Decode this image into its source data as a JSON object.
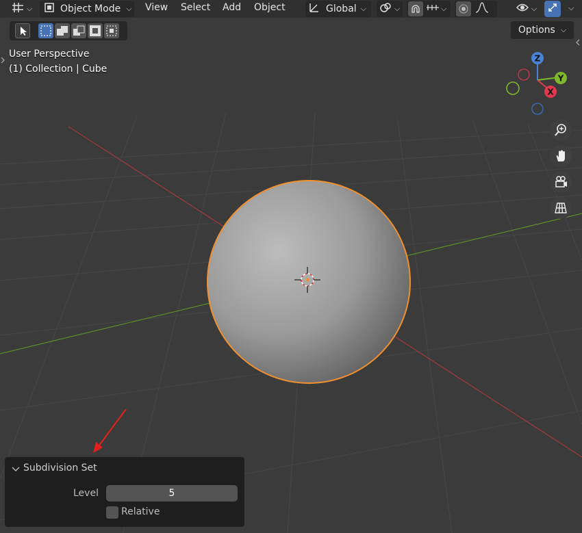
{
  "header": {
    "editor_type_icon": "grid-axes-icon",
    "mode_label": "Object Mode",
    "menus": [
      "View",
      "Select",
      "Add",
      "Object"
    ],
    "transform_orientation": "Global",
    "icons": [
      "pivot-icon",
      "snap-magnet-icon",
      "snap-increment-icon",
      "proportional-edit-icon",
      "falloff-curve-icon",
      "visibility-eye-icon",
      "gizmo-toggle-icon"
    ]
  },
  "toolbar": {
    "select_tool_icon": "cursor-arrow-icon",
    "select_modes": [
      "select-new-icon",
      "select-extend-icon",
      "select-subtract-icon",
      "select-invert-icon",
      "select-intersect-icon"
    ],
    "options_label": "Options"
  },
  "viewport": {
    "view_name": "User Perspective",
    "collection_info": "(1) Collection | Cube",
    "gizmo_axes": [
      "Z",
      "Y",
      "X"
    ],
    "nav_buttons": [
      "zoom-icon",
      "pan-hand-icon",
      "camera-icon",
      "grid-ortho-icon"
    ]
  },
  "operator_panel": {
    "title": "Subdivision Set",
    "level_label": "Level",
    "level_value": "5",
    "relative_label": "Relative",
    "relative_checked": false
  },
  "colors": {
    "selection_outline": "#f0902f",
    "x_axis": "#c94a4a",
    "y_axis": "#6a9a2a",
    "accent_blue": "#4772b3",
    "annotation_arrow": "#e3201b"
  }
}
